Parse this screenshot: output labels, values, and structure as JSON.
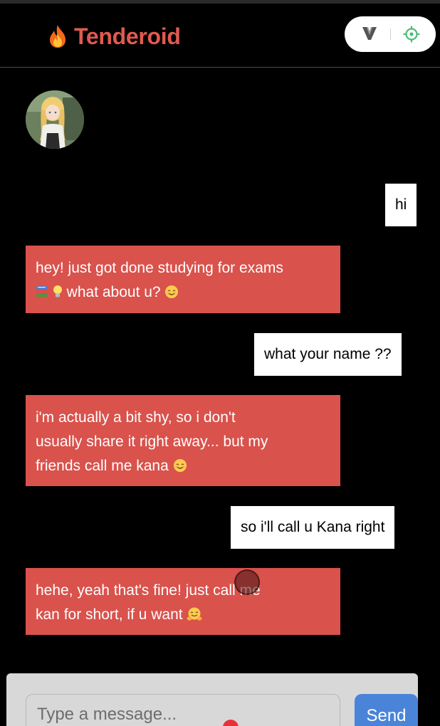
{
  "header": {
    "title": "Tenderoid",
    "logo_icon": "fire-icon",
    "brand_color": "#e05a4f",
    "extension_icons": [
      "v-logo-icon",
      "target-icon"
    ]
  },
  "messages": [
    {
      "role": "user",
      "text": "hi"
    },
    {
      "role": "bot",
      "text": "hey! just got done studying for exams",
      "text_after": " what about u? ",
      "icons": [
        "books-icon",
        "lightbulb-icon",
        "smile-icon"
      ]
    },
    {
      "role": "user",
      "text": "what your name ??"
    },
    {
      "role": "bot",
      "line1": "i'm actually a bit shy, so i don't",
      "line2": "usually share it right away... but my",
      "line3": "friends call me kana ",
      "icons": [
        "smile-icon"
      ]
    },
    {
      "role": "user",
      "text": "so i'll call u Kana right"
    },
    {
      "role": "bot",
      "line1": "hehe, yeah that's fine! just call me",
      "line2": "kan for short, if u want ",
      "icons": [
        "hug-icon"
      ]
    }
  ],
  "input": {
    "placeholder": "Type a message...",
    "value": ""
  },
  "send_label": "Send",
  "colors": {
    "bot_bubble": "#d9524c",
    "user_bubble": "#ffffff",
    "send_button": "#4a84d9",
    "background": "#000000"
  }
}
